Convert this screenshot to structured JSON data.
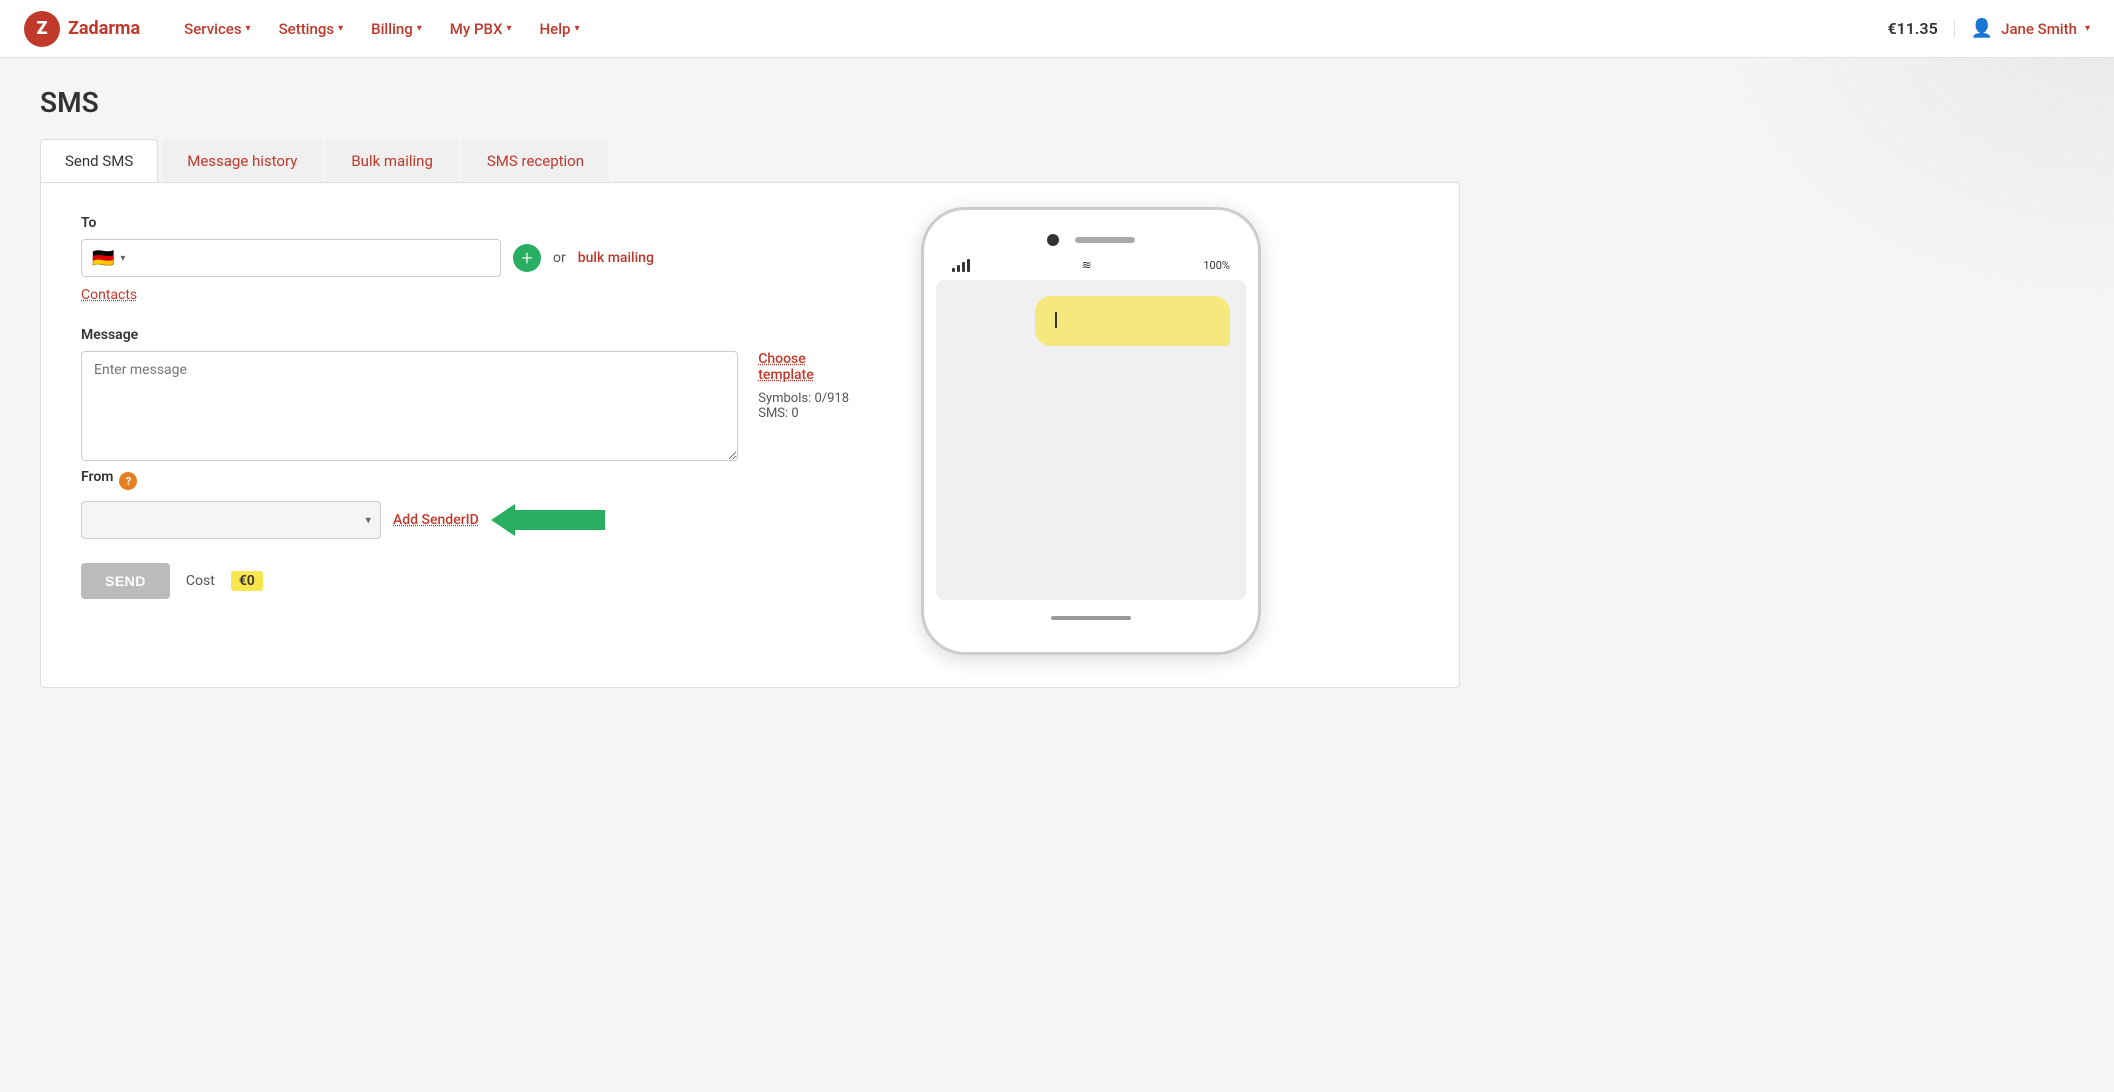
{
  "app": {
    "logo_text": "Zadarma",
    "logo_letter": "Z"
  },
  "nav": {
    "items": [
      {
        "label": "Services",
        "chevron": "▾"
      },
      {
        "label": "Settings",
        "chevron": "▾"
      },
      {
        "label": "Billing",
        "chevron": "▾"
      },
      {
        "label": "My PBX",
        "chevron": "▾"
      },
      {
        "label": "Help",
        "chevron": "▾"
      }
    ]
  },
  "header": {
    "balance": "€11.35",
    "user_name": "Jane Smith",
    "user_chevron": "▾"
  },
  "page": {
    "title": "SMS"
  },
  "tabs": [
    {
      "label": "Send SMS",
      "active": true
    },
    {
      "label": "Message history",
      "active": false
    },
    {
      "label": "Bulk mailing",
      "active": false
    },
    {
      "label": "SMS reception",
      "active": false
    }
  ],
  "form": {
    "to_label": "To",
    "flag": "🇩🇪",
    "or_text": "or",
    "bulk_mailing_link": "bulk mailing",
    "contacts_link": "Contacts",
    "message_label": "Message",
    "message_placeholder": "Enter message",
    "choose_template": "Choose template",
    "symbols_label": "Symbols: 0/918",
    "sms_count_label": "SMS: 0",
    "from_label": "From",
    "from_help": "?",
    "from_placeholder": "",
    "add_sender_link": "Add SenderID",
    "send_btn": "SEND",
    "cost_label": "Cost",
    "cost_value": "€0"
  },
  "phone": {
    "signal": "|||",
    "battery": "100%",
    "wifi": "≋"
  }
}
